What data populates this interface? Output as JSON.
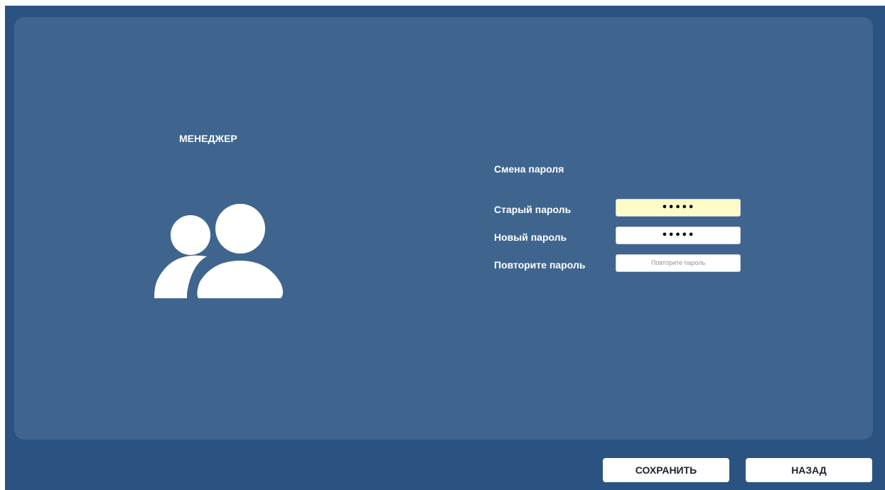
{
  "profile": {
    "role": "МЕНЕДЖЕР",
    "icon": "users-icon"
  },
  "password_form": {
    "title": "Смена пароля",
    "old_password": {
      "label": "Старый пароль",
      "value": "•••••"
    },
    "new_password": {
      "label": "Новый пароль",
      "value": "•••••"
    },
    "repeat_password": {
      "label": "Повторите пароль",
      "value": "",
      "placeholder": "Повторите пароль"
    }
  },
  "actions": {
    "save_label": "СОХРАНИТЬ",
    "back_label": "НАЗАД"
  },
  "colors": {
    "background": "#2b5382",
    "panel": "#3f658f",
    "autofill": "#fffbc7",
    "text": "#ffffff"
  }
}
